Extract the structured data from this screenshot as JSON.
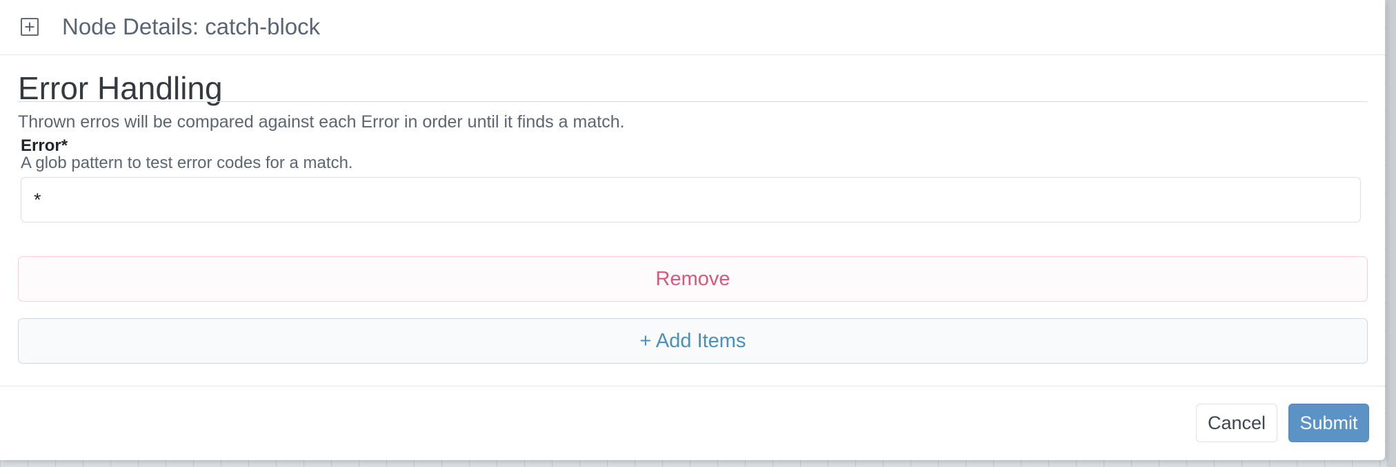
{
  "background": {
    "canvas_color": "#d9dde1",
    "grid_color": "#c3c9ce"
  },
  "modal": {
    "header": {
      "icon": "expand-square-icon",
      "title": "Node Details: catch-block"
    },
    "section": {
      "title": "Error Handling",
      "description": "Thrown erros will be compared against each Error in order until it finds a match."
    },
    "field": {
      "label": "Error*",
      "help": "A glob pattern to test error codes for a match.",
      "value": "*"
    },
    "remove_label": "Remove",
    "add_items_label": "+ Add Items",
    "footer": {
      "cancel_label": "Cancel",
      "submit_label": "Submit"
    }
  },
  "colors": {
    "title_text": "#5a6573",
    "danger": "#d9577a",
    "info": "#4a8fbd",
    "primary": "#5b93c6"
  }
}
